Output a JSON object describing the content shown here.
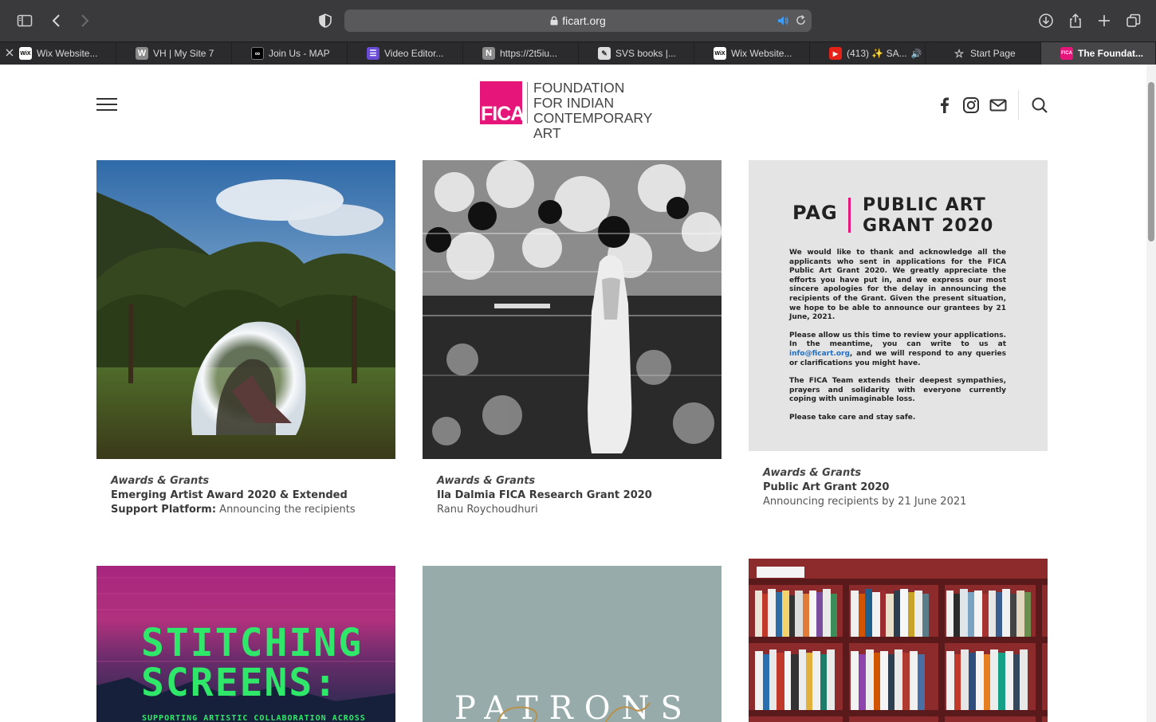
{
  "browser": {
    "url": "ficart.org",
    "tabs": [
      {
        "label": "Wix Website...",
        "icon": "wix-icon",
        "color": "#111111"
      },
      {
        "label": "VH | My Site 7",
        "icon": "w-icon",
        "color": "#8a8a8a"
      },
      {
        "label": "Join Us - MAP",
        "icon": "map-icon",
        "color": "#000000"
      },
      {
        "label": "Video Editor...",
        "icon": "video-editor-icon",
        "color": "#6a4bd6"
      },
      {
        "label": "https://2t5iu...",
        "icon": "n-icon",
        "color": "#8a8a8a"
      },
      {
        "label": "SVS books |...",
        "icon": "book-icon",
        "color": "#cccccc"
      },
      {
        "label": "Wix Website...",
        "icon": "wix-icon",
        "color": "#111111"
      },
      {
        "label": "(413) ✨ SA...",
        "icon": "youtube-icon",
        "color": "#e62117"
      },
      {
        "label": "Start Page",
        "icon": "star-icon",
        "color": "#3a393c"
      },
      {
        "label": "The Foundat...",
        "icon": "fica-icon",
        "color": "#e6157a"
      }
    ]
  },
  "site": {
    "logo_mark": "FICA",
    "logo_lines": [
      "FOUNDATION",
      "FOR INDIAN",
      "CONTEMPORARY ART"
    ],
    "brand_color": "#e6157a"
  },
  "cards": [
    {
      "category": "Awards & Grants",
      "title": "Emerging Artist Award 2020 & Extended Support Platform:",
      "subtitle": "Announcing the recipients"
    },
    {
      "category": "Awards & Grants",
      "title": "Ila Dalmia FICA Research Grant 2020",
      "subtitle": "Ranu Roychoudhuri"
    },
    {
      "category": "Awards & Grants",
      "title": "Public Art Grant 2020",
      "subtitle": "Announcing recipients by 21 June 2021"
    }
  ],
  "pag": {
    "logo": "PAG",
    "title_line1": "PUBLIC ART",
    "title_line2": "GRANT 2020",
    "para1": "We would like to thank and acknowledge all the applicants who sent in applications for the FICA Public Art Grant 2020. We greatly appreciate the efforts you have put in, and we express our most sincere apologies for the delay in announcing the recipients of the Grant. Given the present situation, we hope to be able to announce our grantees by 21 June, 2021.",
    "para2_a": "Please allow us this time to review your applications. In the meantime, you can write to us at ",
    "para2_link": "info@ficart.org",
    "para2_b": ", and we will respond to any queries or clarifications you might have.",
    "para3": "The FICA Team extends their deepest sympathies, prayers and solidarity with everyone currently coping with unimaginable loss.",
    "para4": "Please take care and stay safe."
  },
  "row2": {
    "stitching_line1": "STITCHING",
    "stitching_line2": "SCREENS:",
    "stitching_sub": "SUPPORTING ARTISTIC COLLABORATION ACROSS",
    "patrons": "PATRONS"
  }
}
